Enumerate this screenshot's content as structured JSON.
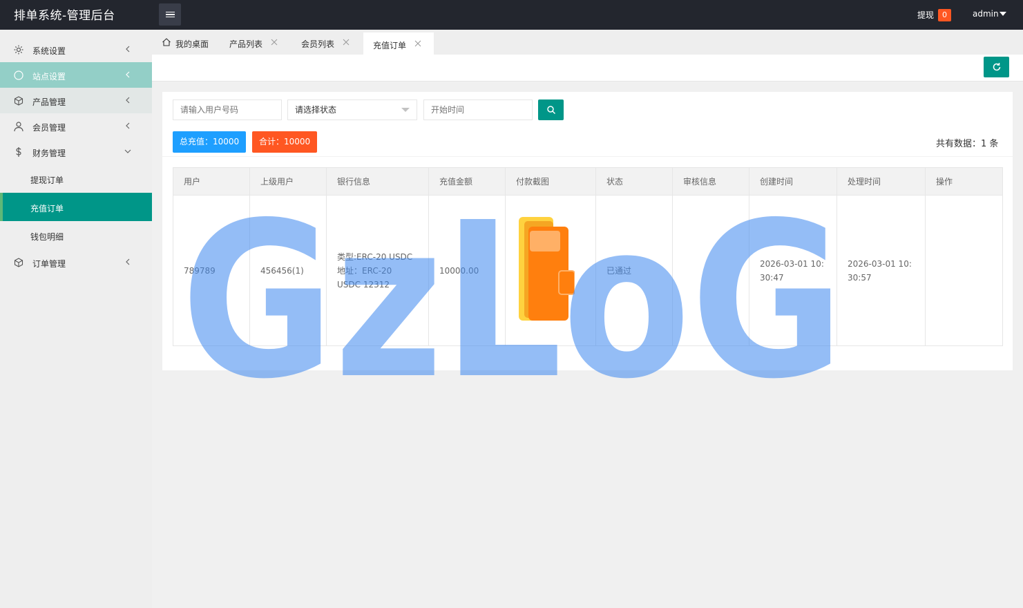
{
  "header": {
    "title": "排单系统-管理后台",
    "withdraw_label": "提现",
    "withdraw_count": "0",
    "user": "admin"
  },
  "sidebar": {
    "items": [
      {
        "label": "系统设置",
        "icon": "gear-icon"
      },
      {
        "label": "站点设置",
        "icon": "globe-icon"
      },
      {
        "label": "产品管理",
        "icon": "cube-icon"
      },
      {
        "label": "会员管理",
        "icon": "user-icon"
      },
      {
        "label": "财务管理",
        "icon": "dollar-icon"
      },
      {
        "label": "提现订单"
      },
      {
        "label": "充值订单"
      },
      {
        "label": "钱包明细"
      },
      {
        "label": "订单管理",
        "icon": "cube-icon"
      }
    ]
  },
  "tabs": [
    {
      "label": "我的桌面",
      "icon": "home-icon"
    },
    {
      "label": "产品列表"
    },
    {
      "label": "会员列表"
    },
    {
      "label": "充值订单"
    }
  ],
  "filters": {
    "user_placeholder": "请输入用户号码",
    "status_selected": "请选择状态",
    "start_time_placeholder": "开始时间"
  },
  "stats": {
    "total_recharge": "总充值：10000",
    "sum": "合计：10000",
    "count": "共有数据：1 条"
  },
  "table": {
    "headers": [
      "用户",
      "上级用户",
      "银行信息",
      "充值金额",
      "付款截图",
      "状态",
      "审核信息",
      "创建时间",
      "处理时间",
      "操作"
    ],
    "rows": [
      {
        "user": "789789",
        "parent": "456456(1)",
        "bank_type": "类型:ERC-20 USDC",
        "bank_addr": "地址：ERC-20 USDC 12312",
        "amount": "10000.00",
        "status": "已通过",
        "audit": "",
        "created": "2026-03-01 10:30:47",
        "processed": "2026-03-01 10:30:57",
        "action": ""
      }
    ]
  },
  "watermark": "GzLoG",
  "colors": {
    "topbar": "#23262e",
    "accent": "#009688",
    "blue": "#1e9fff",
    "orange": "#ff5722"
  }
}
